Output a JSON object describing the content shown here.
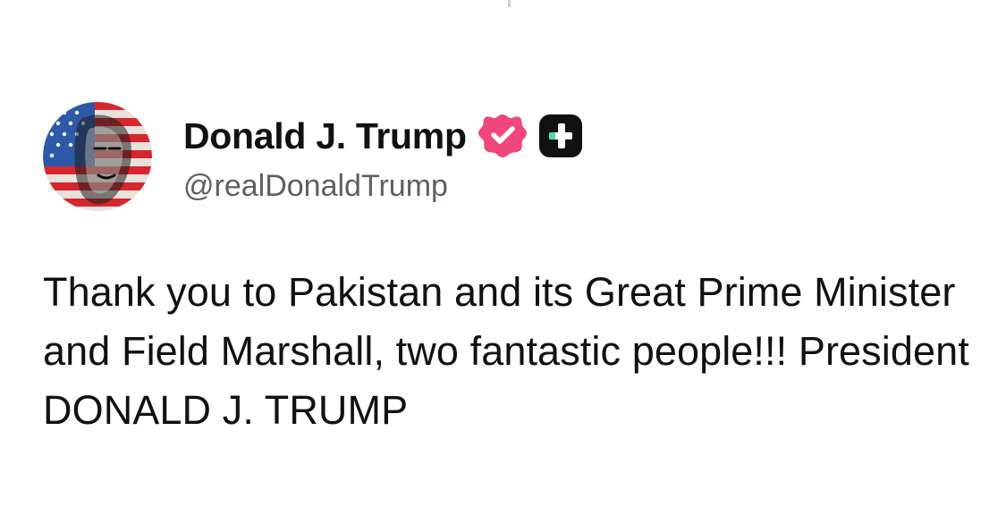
{
  "post": {
    "author": {
      "display_name": "Donald J. Trump",
      "handle": "@realDonaldTrump",
      "avatar_icon": "flag-portrait-avatar",
      "verified_icon": "verified-badge-icon",
      "subscription_icon": "plus-badge-icon"
    },
    "text": "Thank you to Pakistan and its Great Prime Minister and Field Marshall, two fantastic people!!! President DONALD J. TRUMP"
  },
  "colors": {
    "background": "#ffffff",
    "text_primary": "#111111",
    "text_secondary": "#5b6068",
    "verified_badge": "#f0477b",
    "plus_badge_bg": "#111111",
    "plus_badge_accent": "#3ee0b0"
  }
}
